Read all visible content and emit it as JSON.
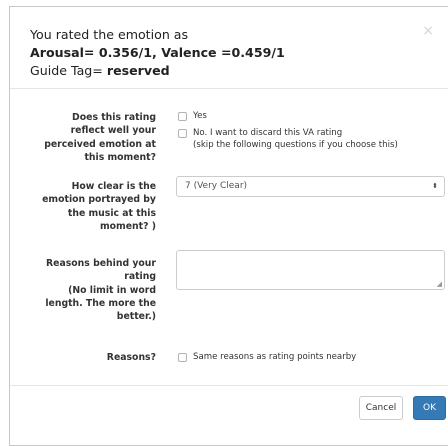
{
  "header": {
    "line1": "You rated the emotion as",
    "line2": "Arousal= 0.356/1, Valence =0.459/1",
    "line3_prefix": "Guide Tag= ",
    "line3_value": "reserved",
    "close_glyph": "×"
  },
  "q1": {
    "label_lines": [
      "Does this rating",
      "reflect  well your",
      "perceived emotion at",
      "this moment?"
    ],
    "option_yes": "Yes",
    "option_no_line1": "No. I want to discard this VA rating",
    "option_no_line2": "(skip the following questions if you choose this)"
  },
  "q2": {
    "label_lines": [
      "How clear is the",
      "emotion portrayed by",
      "the music at this",
      "moment? )"
    ],
    "selected": "7 (Very Clear)",
    "arrow_glyph": "⬍"
  },
  "q3": {
    "label_lines": [
      "Reasons behind your",
      "rating",
      "(No limit in word",
      "length. The more the",
      "better.)"
    ],
    "value": ""
  },
  "q4": {
    "label": "Reasons?",
    "option": "Same reasons as rating points nearby"
  },
  "footer": {
    "cancel_label": "Cancel",
    "ok_label": "OK"
  }
}
